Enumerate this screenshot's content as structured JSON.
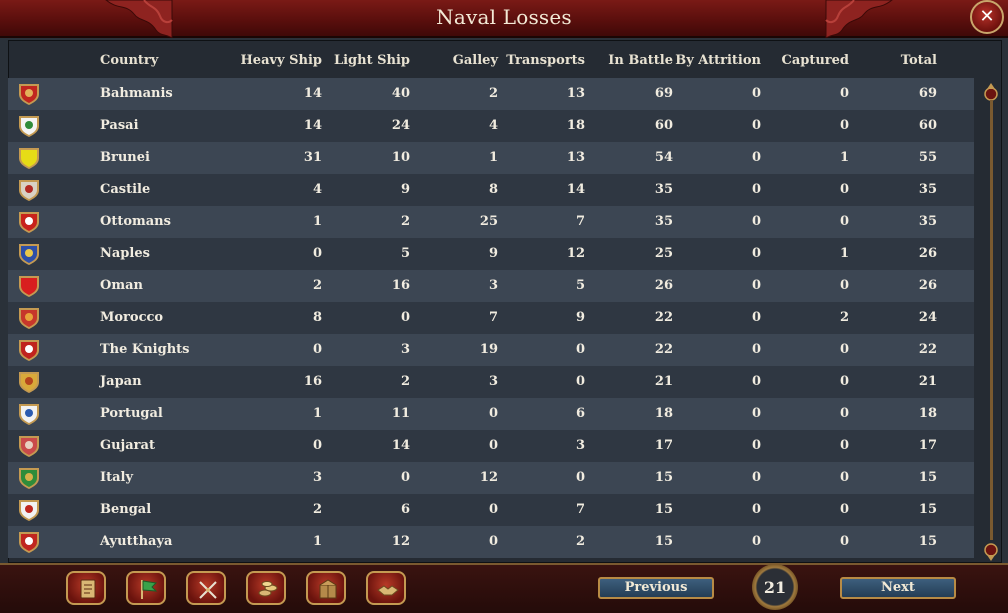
{
  "window": {
    "title": "Naval Losses",
    "close_label": "✕"
  },
  "columns": {
    "country": "Country",
    "heavy": "Heavy Ship",
    "light": "Light Ship",
    "galley": "Galley",
    "transports": "Transports",
    "battle": "In Battle",
    "attrition": "By Attrition",
    "captured": "Captured",
    "total": "Total"
  },
  "rows": [
    {
      "country": "Bahmanis",
      "heavy": "14",
      "light": "40",
      "galley": "2",
      "transports": "13",
      "battle": "69",
      "attrition": "0",
      "captured": "0",
      "total": "69",
      "flag": "#c0261f",
      "mark": "#e2b15a"
    },
    {
      "country": "Pasai",
      "heavy": "14",
      "light": "24",
      "galley": "4",
      "transports": "18",
      "battle": "60",
      "attrition": "0",
      "captured": "0",
      "total": "60",
      "flag": "#f4f4f4",
      "mark": "#2f8c3a"
    },
    {
      "country": "Brunei",
      "heavy": "31",
      "light": "10",
      "galley": "1",
      "transports": "13",
      "battle": "54",
      "attrition": "0",
      "captured": "1",
      "total": "55",
      "flag": "#e6dc16",
      "mark": "#e6dc16"
    },
    {
      "country": "Castile",
      "heavy": "4",
      "light": "9",
      "galley": "8",
      "transports": "14",
      "battle": "35",
      "attrition": "0",
      "captured": "0",
      "total": "35",
      "flag": "#d9d2c4",
      "mark": "#b32a24"
    },
    {
      "country": "Ottomans",
      "heavy": "1",
      "light": "2",
      "galley": "25",
      "transports": "7",
      "battle": "35",
      "attrition": "0",
      "captured": "0",
      "total": "35",
      "flag": "#c8221b",
      "mark": "#ffffff"
    },
    {
      "country": "Naples",
      "heavy": "0",
      "light": "5",
      "galley": "9",
      "transports": "12",
      "battle": "25",
      "attrition": "0",
      "captured": "1",
      "total": "26",
      "flag": "#2d4fa8",
      "mark": "#e9c84a"
    },
    {
      "country": "Oman",
      "heavy": "2",
      "light": "16",
      "galley": "3",
      "transports": "5",
      "battle": "26",
      "attrition": "0",
      "captured": "0",
      "total": "26",
      "flag": "#d81f1f",
      "mark": "#d81f1f"
    },
    {
      "country": "Morocco",
      "heavy": "8",
      "light": "0",
      "galley": "7",
      "transports": "9",
      "battle": "22",
      "attrition": "0",
      "captured": "2",
      "total": "24",
      "flag": "#c6372b",
      "mark": "#e8a33a"
    },
    {
      "country": "The Knights",
      "heavy": "0",
      "light": "3",
      "galley": "19",
      "transports": "0",
      "battle": "22",
      "attrition": "0",
      "captured": "0",
      "total": "22",
      "flag": "#c0231e",
      "mark": "#ffffff"
    },
    {
      "country": "Japan",
      "heavy": "16",
      "light": "2",
      "galley": "3",
      "transports": "0",
      "battle": "21",
      "attrition": "0",
      "captured": "0",
      "total": "21",
      "flag": "#d9a93a",
      "mark": "#b5451d"
    },
    {
      "country": "Portugal",
      "heavy": "1",
      "light": "11",
      "galley": "0",
      "transports": "6",
      "battle": "18",
      "attrition": "0",
      "captured": "0",
      "total": "18",
      "flag": "#f2f2f2",
      "mark": "#2b5bb0"
    },
    {
      "country": "Gujarat",
      "heavy": "0",
      "light": "14",
      "galley": "0",
      "transports": "3",
      "battle": "17",
      "attrition": "0",
      "captured": "0",
      "total": "17",
      "flag": "#c94a4a",
      "mark": "#e8d0c0"
    },
    {
      "country": "Italy",
      "heavy": "3",
      "light": "0",
      "galley": "12",
      "transports": "0",
      "battle": "15",
      "attrition": "0",
      "captured": "0",
      "total": "15",
      "flag": "#2f8c3a",
      "mark": "#d8b04a"
    },
    {
      "country": "Bengal",
      "heavy": "2",
      "light": "6",
      "galley": "0",
      "transports": "7",
      "battle": "15",
      "attrition": "0",
      "captured": "0",
      "total": "15",
      "flag": "#f2f2f2",
      "mark": "#c0261f"
    },
    {
      "country": "Ayutthaya",
      "heavy": "1",
      "light": "12",
      "galley": "0",
      "transports": "2",
      "battle": "15",
      "attrition": "0",
      "captured": "0",
      "total": "15",
      "flag": "#c0261f",
      "mark": "#ffffff"
    }
  ],
  "bottom": {
    "tools": [
      "ledger-icon",
      "flag-icon",
      "crossed-swords-icon",
      "coins-icon",
      "trade-goods-icon",
      "handshake-icon"
    ],
    "previous_label": "Previous",
    "next_label": "Next",
    "page": "21"
  }
}
